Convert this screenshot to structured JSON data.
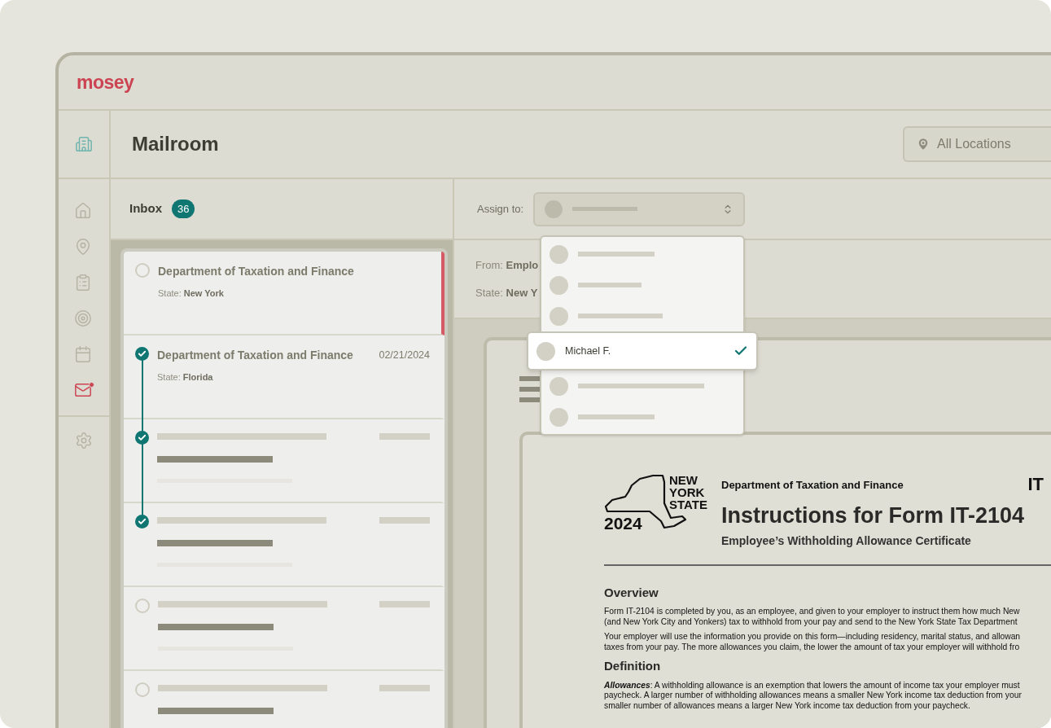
{
  "brand": {
    "logo": "mosey"
  },
  "sidebar": {
    "items": [
      {
        "selected": false,
        "notification": false
      },
      {
        "selected": false,
        "notification": false
      },
      {
        "selected": false,
        "notification": false
      },
      {
        "selected": false,
        "notification": false
      },
      {
        "selected": false,
        "notification": false
      },
      {
        "selected": true,
        "notification": true
      }
    ]
  },
  "header": {
    "title": "Mailroom",
    "location_select": {
      "value": "All Locations"
    }
  },
  "inbox": {
    "title": "Inbox",
    "count": "36",
    "messages": [
      {
        "kind": "message",
        "title": "Department of Taxation and Finance",
        "state_label": "State:",
        "state": "New York",
        "checked": false,
        "selected": true
      },
      {
        "kind": "message",
        "title": "Department of Taxation and Finance",
        "date": "02/21/2024",
        "state_label": "State:",
        "state": "Florida",
        "checked": true,
        "selected": false
      },
      {
        "kind": "placeholder",
        "checked": true,
        "selected": false
      },
      {
        "kind": "placeholder",
        "checked": true,
        "selected": false
      },
      {
        "kind": "placeholder",
        "checked": false,
        "selected": false
      },
      {
        "kind": "placeholder",
        "checked": false,
        "selected": false
      }
    ]
  },
  "detail": {
    "assign": {
      "label": "Assign to:",
      "expanded": true,
      "options": [
        {
          "kind": "placeholder",
          "selected": false
        },
        {
          "kind": "placeholder",
          "selected": false
        },
        {
          "kind": "placeholder",
          "selected": false
        },
        {
          "kind": "person",
          "name": "Michael F.",
          "selected": true
        },
        {
          "kind": "placeholder",
          "selected": false
        },
        {
          "kind": "placeholder",
          "selected": false
        }
      ]
    },
    "from_label": "From:",
    "from": "Emplo",
    "state_label": "State:",
    "state": "New Y",
    "document": {
      "logo_words": [
        "NEW",
        "YORK",
        "STATE"
      ],
      "logo_year": "2024",
      "agency": "Department of Taxation and Finance",
      "form_code": "IT",
      "title": "Instructions for Form IT-2104",
      "subtitle": "Employee’s Withholding Allowance Certificate",
      "sections": [
        {
          "heading": "Overview",
          "paragraphs": [
            [
              "Form IT-2104 is completed by you, as an employee, and given to your employer to instruct them how much New",
              "(and New York City and Yonkers) tax to withhold from your pay and send to the New York State Tax Department"
            ],
            [
              "Your employer will use the information you provide on this form—including residency, marital status, and allowan",
              "taxes from your pay. The more allowances you claim, the lower the amount of tax your employer will withhold fro"
            ]
          ]
        },
        {
          "heading": "Definition",
          "paragraphs": [
            [
              "**Allowances**: A withholding allowance is an exemption that lowers the amount of income tax your employer must",
              "paycheck. A larger number of withholding allowances means a smaller New York income tax deduction from your",
              "smaller number of allowances means a larger New York income tax deduction from your paycheck."
            ]
          ]
        }
      ]
    }
  }
}
